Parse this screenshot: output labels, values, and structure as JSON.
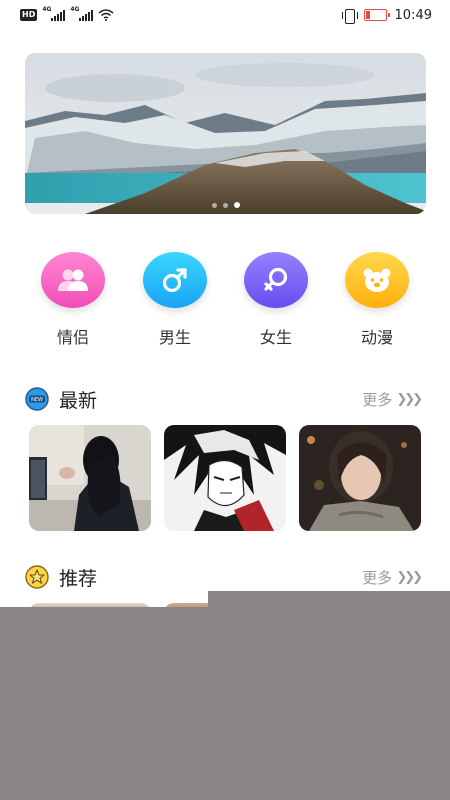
{
  "status_bar": {
    "badge": "HD",
    "network_1": "4G",
    "network_2": "4G",
    "time": "10:49"
  },
  "banner": {
    "dot_count": 3,
    "active_index": 2
  },
  "categories": [
    {
      "label": "情侣",
      "icon": "couple-icon",
      "color_from": "#ff7fcf",
      "color_to": "#f049b5"
    },
    {
      "label": "男生",
      "icon": "male-icon",
      "color_from": "#37d2ff",
      "color_to": "#1aa6f5"
    },
    {
      "label": "女生",
      "icon": "female-icon",
      "color_from": "#8f78ff",
      "color_to": "#6a4ff0"
    },
    {
      "label": "动漫",
      "icon": "bear-icon",
      "color_from": "#ffd54a",
      "color_to": "#ffb20e"
    }
  ],
  "sections": {
    "latest": {
      "title": "最新",
      "more": "更多"
    },
    "recommend": {
      "title": "推荐",
      "more": "更多"
    }
  }
}
